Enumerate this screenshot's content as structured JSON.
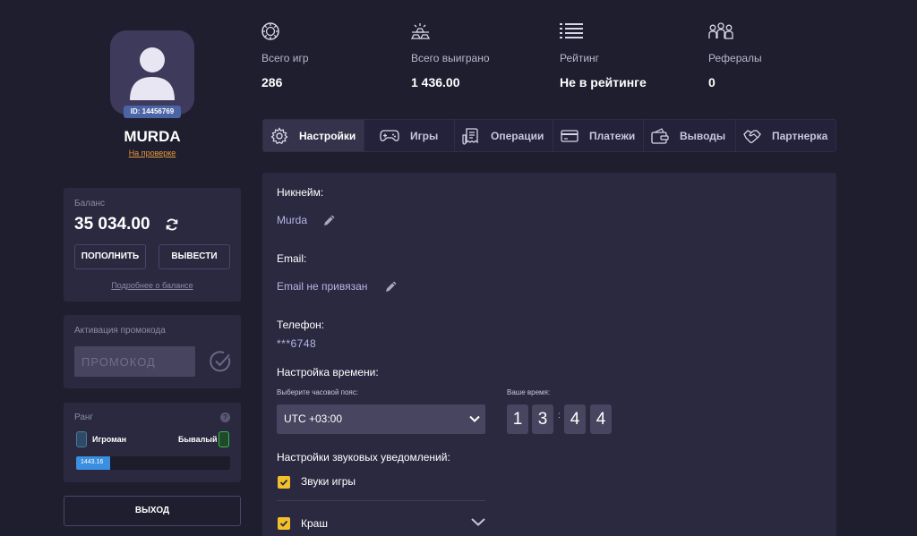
{
  "profile": {
    "id_badge": "ID: 14456769",
    "username": "MURDA",
    "status_link": "На проверке"
  },
  "balance": {
    "label": "Баланс",
    "value": "35 034.00",
    "deposit_label": "ПОПОЛНИТЬ",
    "withdraw_label": "ВЫВЕСТИ",
    "details_link": "Подробнее о балансе"
  },
  "promo": {
    "label": "Активация промокода",
    "placeholder": "ПРОМОКОД"
  },
  "rank": {
    "label": "Ранг",
    "help": "?",
    "current": "Игроман",
    "next": "Бывалый",
    "progress_text": "1443.16",
    "progress_fraction": 0.22
  },
  "logout_label": "ВЫХОД",
  "stats": [
    {
      "icon": "poker-chip-icon",
      "label": "Всего игр",
      "value": "286"
    },
    {
      "icon": "gold-bars-icon",
      "label": "Всего выиграно",
      "value": "1 436.00"
    },
    {
      "icon": "list-icon",
      "label": "Рейтинг",
      "value": "Не в рейтинге"
    },
    {
      "icon": "users-icon",
      "label": "Рефералы",
      "value": "0"
    }
  ],
  "tabs": [
    {
      "icon": "gear-icon",
      "label": "Настройки",
      "active": true
    },
    {
      "icon": "gamepad-icon",
      "label": "Игры",
      "active": false
    },
    {
      "icon": "receipt-icon",
      "label": "Операции",
      "active": false
    },
    {
      "icon": "card-icon",
      "label": "Платежи",
      "active": false
    },
    {
      "icon": "wallet-icon",
      "label": "Выводы",
      "active": false
    },
    {
      "icon": "handshake-icon",
      "label": "Партнерка",
      "active": false
    }
  ],
  "settings": {
    "nickname_label": "Никнейм:",
    "nickname_value": "Murda",
    "email_label": "Email:",
    "email_value": "Email не привязан",
    "phone_label": "Телефон:",
    "phone_value": "***6748",
    "time_label": "Настройка времени:",
    "timezone_label": "Выберите часовой пояс:",
    "timezone_value": "UTC +03:00",
    "your_time_label": "Ваше время:",
    "time_digits": [
      "1",
      "3",
      "4",
      "4"
    ],
    "time_separator": ":",
    "sound_label": "Настройки звуковых уведомлений:",
    "sound_items": [
      {
        "label": "Звуки игры",
        "checked": true
      },
      {
        "label": "Краш",
        "checked": true
      }
    ]
  },
  "colors": {
    "background": "#1f1e2e",
    "card": "#2a2940",
    "accent_blue": "#4a64a6",
    "link_orange": "#e89a3c",
    "checkbox_yellow": "#f1c02c",
    "progress_blue": "#3a8fe0"
  }
}
